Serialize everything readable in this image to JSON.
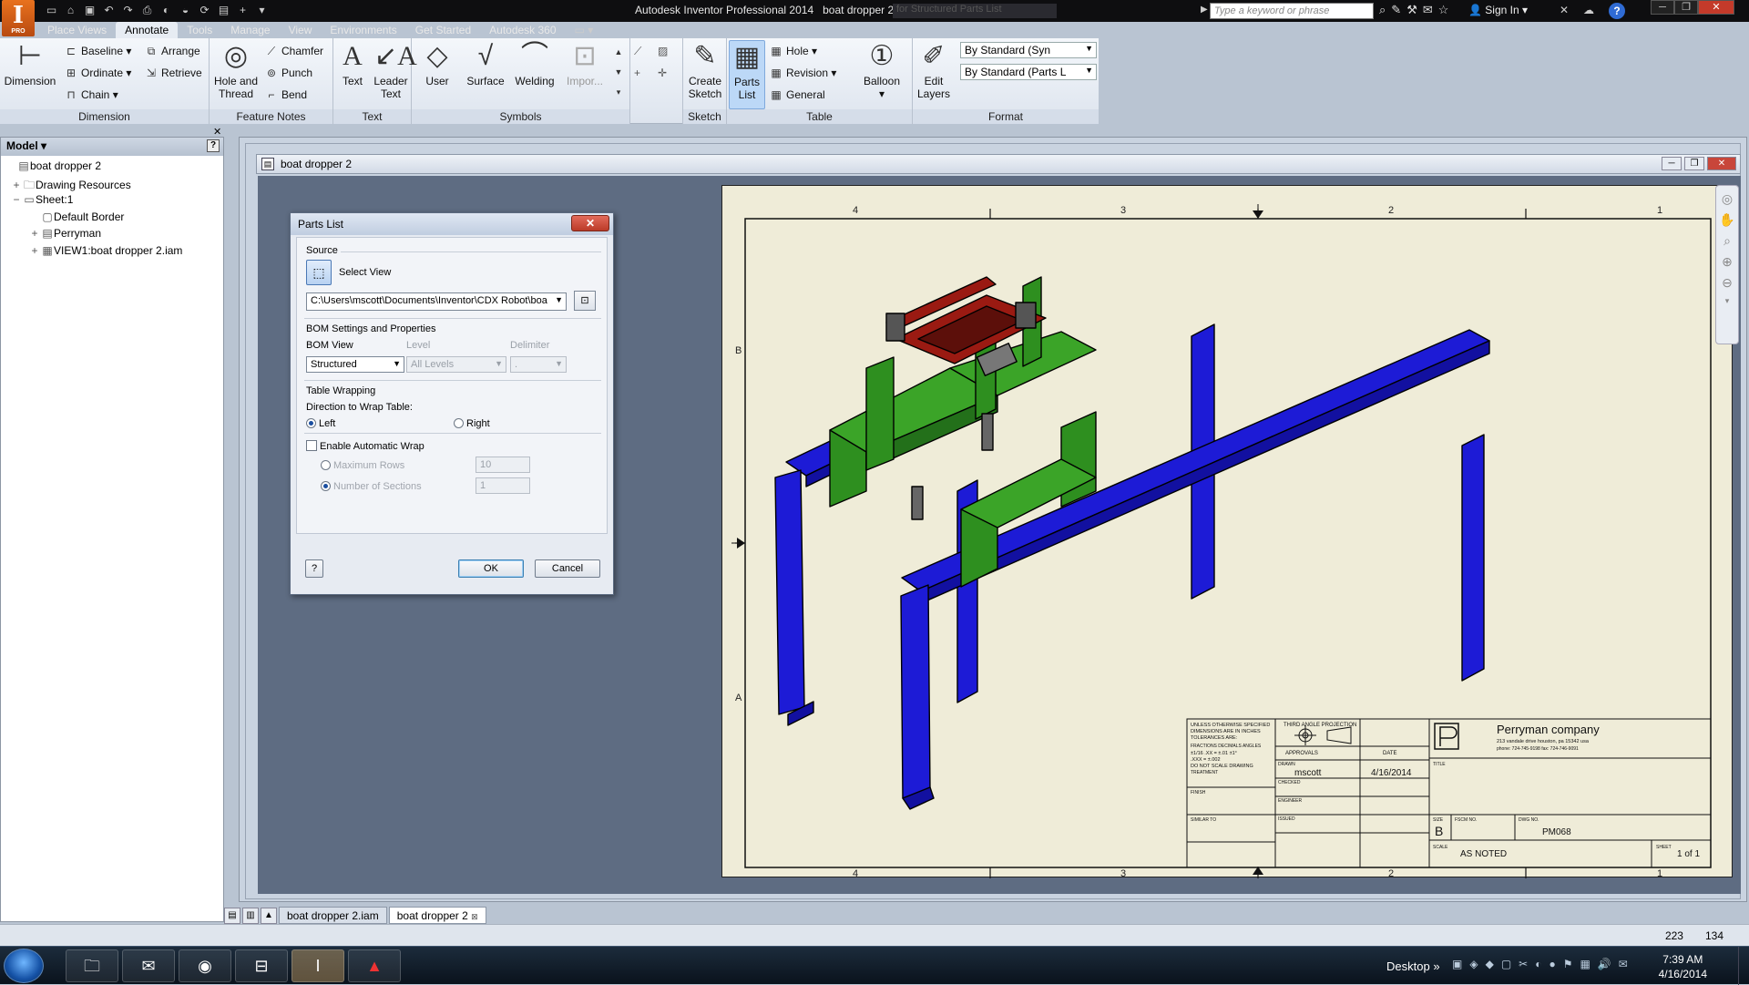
{
  "app": {
    "logo_letter": "I",
    "logo_sub": "PRO",
    "title_app": "Autodesk Inventor Professional 2014",
    "title_doc": "boat dropper 2",
    "ghost_tab": "for Structured Parts List",
    "search_placeholder": "Type a keyword or phrase",
    "sign_in": "Sign In"
  },
  "tabs": [
    "Place Views",
    "Annotate",
    "Tools",
    "Manage",
    "View",
    "Environments",
    "Get Started",
    "Autodesk 360"
  ],
  "active_tab": "Annotate",
  "ribbon": {
    "dimension": {
      "big": "Dimension",
      "baseline": "Baseline",
      "ordinate": "Ordinate",
      "chain": "Chain",
      "arrange": "Arrange",
      "retrieve": "Retrieve",
      "label": "Dimension"
    },
    "feature_notes": {
      "hole_thread_1": "Hole and",
      "hole_thread_2": "Thread",
      "chamfer": "Chamfer",
      "punch": "Punch",
      "bend": "Bend",
      "label": "Feature Notes"
    },
    "text": {
      "text": "Text",
      "leader_1": "Leader",
      "leader_2": "Text",
      "label": "Text"
    },
    "symbols": {
      "user": "User",
      "surface": "Surface",
      "welding": "Welding",
      "import": "Impor...",
      "label": "Symbols"
    },
    "sketch": {
      "create_1": "Create",
      "create_2": "Sketch",
      "label": "Sketch"
    },
    "table": {
      "parts_1": "Parts",
      "parts_2": "List",
      "hole": "Hole",
      "revision": "Revision",
      "general": "General",
      "balloon": "Balloon",
      "label": "Table"
    },
    "format": {
      "edit_1": "Edit",
      "edit_2": "Layers",
      "style1": "By Standard (Syn",
      "style2": "By Standard (Parts L",
      "label": "Format"
    }
  },
  "browser": {
    "header": "Model",
    "items": [
      {
        "label": "boat dropper 2",
        "expander": ""
      },
      {
        "label": "Drawing Resources",
        "expander": "+"
      },
      {
        "label": "Sheet:1",
        "expander": "−"
      },
      {
        "label": "Default Border",
        "expander": ""
      },
      {
        "label": "Perryman",
        "expander": "+"
      },
      {
        "label": "VIEW1:boat dropper 2.iam",
        "expander": "+"
      }
    ]
  },
  "document": {
    "title": "boat dropper 2"
  },
  "dialog": {
    "title": "Parts List",
    "source_label": "Source",
    "select_view": "Select View",
    "file_path": "C:\\Users\\mscott\\Documents\\Inventor\\CDX Robot\\boa",
    "bom_group": "BOM Settings and Properties",
    "bom_view_label": "BOM View",
    "bom_view_value": "Structured",
    "level_label": "Level",
    "level_value": "All Levels",
    "delimiter_label": "Delimiter",
    "delimiter_value": ".",
    "wrap_group": "Table Wrapping",
    "direction_label": "Direction to Wrap Table:",
    "left": "Left",
    "right": "Right",
    "enable_wrap": "Enable Automatic Wrap",
    "max_rows_label": "Maximum Rows",
    "max_rows_value": "10",
    "num_sections_label": "Number of Sections",
    "num_sections_value": "1",
    "ok": "OK",
    "cancel": "Cancel"
  },
  "sheet": {
    "zone_cols": [
      "4",
      "3",
      "2",
      "1"
    ],
    "zone_rows": [
      "B",
      "A"
    ],
    "title_block": {
      "company": "Perryman company",
      "address": "213 vandale drive houston, pa 15342 usa",
      "phone": "phone: 724-745-9198 fax: 724-746-9091",
      "projection": "THIRD ANGLE PROJECTION",
      "notes": [
        "UNLESS OTHERWISE SPECIFIED",
        "DIMENSIONS ARE IN INCHES",
        "TOLERANCES ARE:",
        "FRACTIONS  DECIMALS  ANGLES",
        "±1/16  .XX = ±.01  ±1°",
        "       .XXX = ±.002",
        "DO NOT SCALE DRAWING"
      ],
      "treatment": "TREATMENT",
      "finish": "FINISH",
      "similar_to": "SIMILAR TO",
      "approvals": "APPROVALS",
      "date_header": "DATE",
      "drawn": "DRAWN",
      "drawn_by": "mscott",
      "date": "4/16/2014",
      "checked": "CHECKED",
      "engineer": "ENGINEER",
      "issued": "ISSUED",
      "title": "TITLE",
      "size_label": "SIZE",
      "size": "B",
      "fscm": "FSCM NO.",
      "dwg_label": "DWG NO.",
      "dwg_no": "PM068",
      "scale_label": "SCALE",
      "scale": "AS NOTED",
      "sheet_label": "SHEET",
      "sheet": "1 of 1"
    }
  },
  "doc_tabs": [
    "boat dropper 2.iam",
    "boat dropper 2"
  ],
  "active_doc_tab": "boat dropper 2",
  "status": {
    "x": "223",
    "y": "134"
  },
  "taskbar": {
    "desktop": "Desktop",
    "time": "7:39 AM",
    "date": "4/16/2014"
  },
  "colors": {
    "frame_green": "#2e8f1f",
    "rails_blue": "#1d1bd6",
    "top_red": "#9a1a12",
    "sheet_bg": "#efecd8"
  }
}
